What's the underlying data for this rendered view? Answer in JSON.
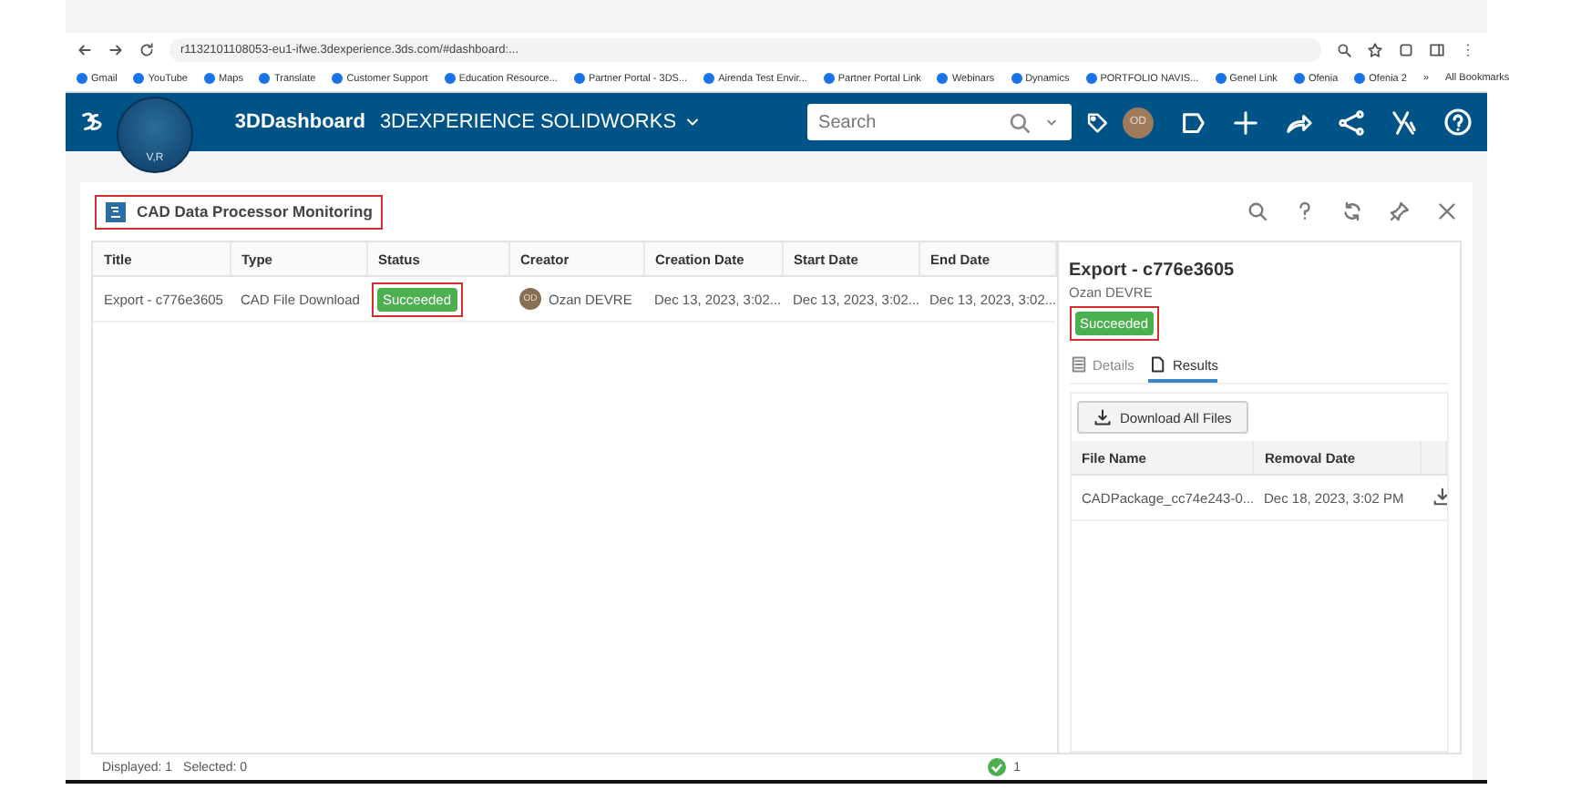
{
  "browser": {
    "url": "r1132101108053-eu1-ifwe.3dexperience.3ds.com/#dashboard:...",
    "bookmarks": [
      "Gmail",
      "YouTube",
      "Maps",
      "Translate",
      "Customer Support",
      "Education Resource...",
      "Partner Portal - 3DS...",
      "Airenda Test Envir...",
      "Partner Portal Link",
      "Webinars",
      "Dynamics",
      "PORTFOLIO NAVIS...",
      "Genel Link",
      "Ofenia",
      "Ofenia 2"
    ],
    "more": "»",
    "all_bookmarks": "All Bookmarks"
  },
  "header": {
    "app": "3DDashboard",
    "platform": "3DEXPERIENCE SOLIDWORKS",
    "compass_label": "V,R",
    "search": {
      "placeholder": "Search"
    },
    "avatar": "OD"
  },
  "widget": {
    "title": "CAD Data Processor Monitoring",
    "highlighted": true
  },
  "table": {
    "columns": [
      "Title",
      "Type",
      "Status",
      "Creator",
      "Creation Date",
      "Start Date",
      "End Date"
    ],
    "rows": [
      {
        "title": "Export - c776e3605",
        "type": "CAD File Download",
        "status": "Succeeded",
        "status_highlighted": true,
        "creator_initials": "OD",
        "creator": "Ozan DEVRE",
        "creation_date": "Dec 13, 2023, 3:02...",
        "start_date": "Dec 13, 2023, 3:02...",
        "end_date": "Dec 13, 2023, 3:02...",
        "selected": false
      }
    ]
  },
  "details": {
    "title": "Export - c776e3605",
    "creator": "Ozan DEVRE",
    "status": "Succeeded",
    "status_highlighted": true,
    "tabs": [
      {
        "label": "Details",
        "selected": false
      },
      {
        "label": "Results",
        "selected": true
      }
    ],
    "download_all": "Download All Files",
    "columns": [
      "File Name",
      "Removal Date"
    ],
    "files": [
      {
        "name": "CADPackage_cc74e243-0...",
        "removal_date": "Dec 18, 2023, 3:02 PM"
      }
    ]
  },
  "status_bar": {
    "displayed": "Displayed: 1",
    "selected": "Selected: 0",
    "success_count": "1"
  }
}
